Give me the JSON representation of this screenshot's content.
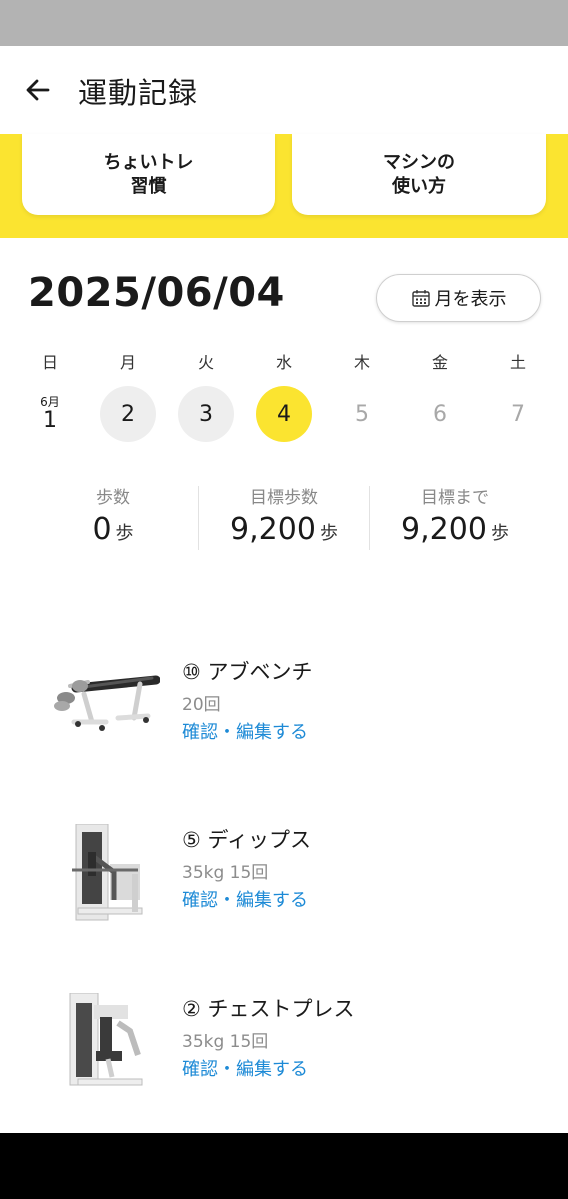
{
  "header": {
    "title": "運動記録"
  },
  "shortcuts": [
    {
      "label": "ちょいトレ\n習慣"
    },
    {
      "label": "マシンの\n使い方"
    }
  ],
  "date": {
    "display": "2025/06/04",
    "month_button": "月を表示"
  },
  "week": {
    "weekdays": [
      "日",
      "月",
      "火",
      "水",
      "木",
      "金",
      "土"
    ],
    "first_month": "6月",
    "days": [
      "1",
      "2",
      "3",
      "4",
      "5",
      "6",
      "7"
    ],
    "selected": "4"
  },
  "stats": [
    {
      "label": "歩数",
      "value": "0",
      "unit": "歩"
    },
    {
      "label": "目標歩数",
      "value": "9,200",
      "unit": "歩"
    },
    {
      "label": "目標まで",
      "value": "9,200",
      "unit": "歩"
    }
  ],
  "workouts": [
    {
      "name": "⑩ アブベンチ",
      "detail": "20回",
      "action": "確認・編集する",
      "icon": "ab-bench-machine-icon"
    },
    {
      "name": "⑤ ディップス",
      "detail": "35kg 15回",
      "action": "確認・編集する",
      "icon": "dips-machine-icon"
    },
    {
      "name": "② チェストプレス",
      "detail": "35kg 15回",
      "action": "確認・編集する",
      "icon": "chest-press-machine-icon"
    }
  ],
  "colors": {
    "accent_yellow": "#fbe430",
    "link_blue": "#1d8ad6",
    "muted_gray": "#888888"
  }
}
